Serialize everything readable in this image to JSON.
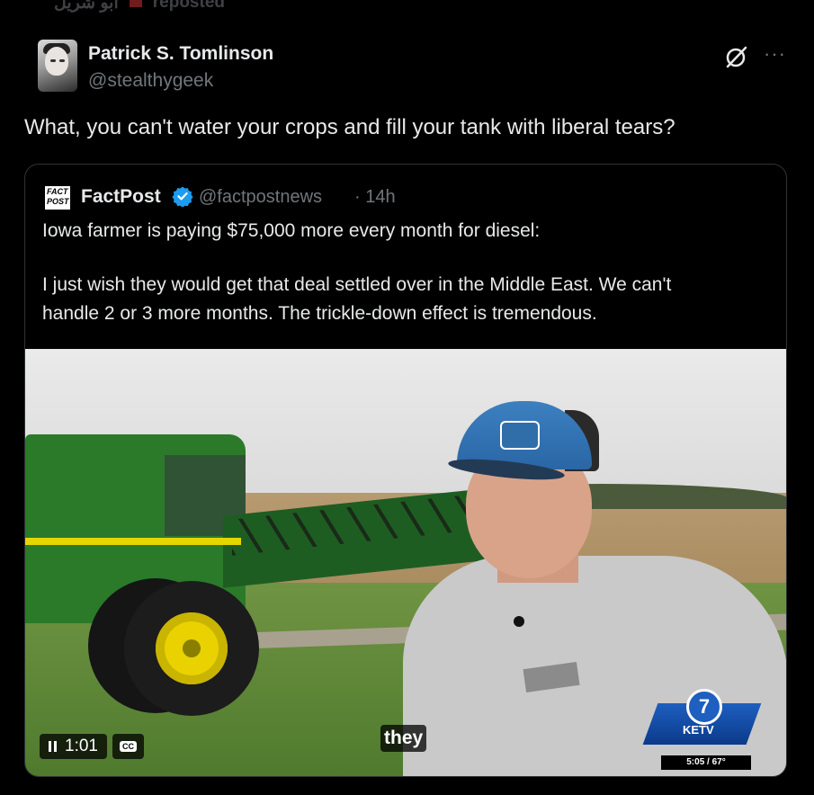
{
  "repost": {
    "text": "ابو شريل",
    "label": "reposted"
  },
  "post": {
    "author_name": "Patrick S. Tomlinson",
    "author_handle": "@stealthygeek",
    "more_label": "···",
    "text": "What, you can't water your crops and fill your tank with liberal tears?"
  },
  "quote": {
    "logo_text": "FACT POST",
    "name": "FactPost",
    "handle": "@factpostnews",
    "time": "· 14h",
    "line1": "Iowa farmer is paying $75,000 more every month for diesel:",
    "line2": "I just wish they would get that deal settled over in the Middle East. We can't",
    "line3": "handle 2 or 3 more months. The trickle-down effect is tremendous."
  },
  "video": {
    "time": "1:01",
    "cc_label": "CC",
    "caption": "they",
    "station_number": "7",
    "station_name": "KETV",
    "station_info": "5:05 / 67°"
  },
  "colors": {
    "background": "#000000",
    "text": "#e7e9ea",
    "muted": "#71767b",
    "border": "#2f3336",
    "verified": "#1d9bf0"
  }
}
